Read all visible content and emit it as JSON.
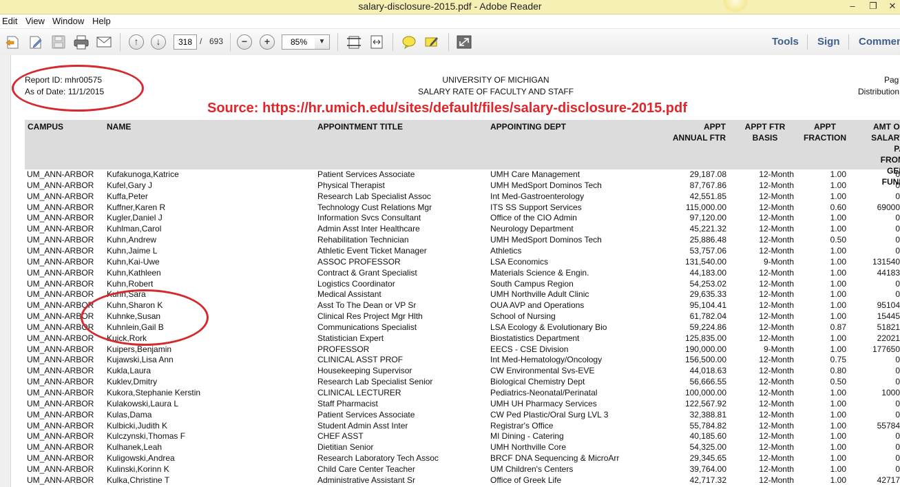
{
  "window": {
    "title": "salary-disclosure-2015.pdf - Adobe Reader",
    "minimize": "–",
    "restore": "❐",
    "close": "✕"
  },
  "menu": {
    "items": [
      "Edit",
      "View",
      "Window",
      "Help"
    ]
  },
  "toolbar": {
    "current_page": "318",
    "page_separator": "/",
    "total_pages": "693",
    "zoom": "85%",
    "zoom_out": "−",
    "zoom_in": "+",
    "prev_page": "↑",
    "next_page": "↓",
    "dropdown_arrow": "▼",
    "tools": "Tools",
    "sign": "Sign",
    "comment": "Commen"
  },
  "report": {
    "report_id": "Report ID: mhr00575",
    "as_of_date": "As of Date: 11/1/2015",
    "university": "UNIVERSITY OF MICHIGAN",
    "subtitle": "SALARY RATE OF FACULTY AND STAFF",
    "page_label": "Pag",
    "distribution_label": "Distribution",
    "source_note": "Source: https://hr.umich.edu/sites/default/files/salary-disclosure-2015.pdf"
  },
  "columns": {
    "campus": "CAMPUS",
    "name": "NAME",
    "title": "APPOINTMENT TITLE",
    "dept": "APPOINTING DEPT",
    "ftr": [
      "APPT",
      "ANNUAL FTR"
    ],
    "basis": [
      "APPT FTR",
      "BASIS"
    ],
    "fraction": [
      "APPT",
      "FRACTION"
    ],
    "gf": [
      "AMT OF",
      "SALARY PA",
      "FROM GEN",
      "FUND"
    ]
  },
  "rows": [
    [
      "UM_ANN-ARBOR",
      "Kufakunoga,Katrice",
      "Patient Services Associate",
      "UMH Care Management",
      "29,187.08",
      "12-Month",
      "1.00",
      "0"
    ],
    [
      "UM_ANN-ARBOR",
      "Kufel,Gary J",
      "Physical Therapist",
      "UMH MedSport Dominos Tech",
      "87,767.86",
      "12-Month",
      "1.00",
      "0"
    ],
    [
      "UM_ANN-ARBOR",
      "Kuffa,Peter",
      "Research Lab Specialist Assoc",
      "Int Med-Gastroenterology",
      "42,551.85",
      "12-Month",
      "1.00",
      "0"
    ],
    [
      "UM_ANN-ARBOR",
      "Kuffner,Karen R",
      "Technology Cust Relations Mgr",
      "ITS SS Support Services",
      "115,000.00",
      "12-Month",
      "0.60",
      "69000"
    ],
    [
      "UM_ANN-ARBOR",
      "Kugler,Daniel J",
      "Information Svcs Consultant",
      "Office of the CIO Admin",
      "97,120.00",
      "12-Month",
      "1.00",
      "0"
    ],
    [
      "UM_ANN-ARBOR",
      "Kuhlman,Carol",
      "Admin Asst Inter Healthcare",
      "Neurology Department",
      "45,221.32",
      "12-Month",
      "1.00",
      "0"
    ],
    [
      "UM_ANN-ARBOR",
      "Kuhn,Andrew",
      "Rehabilitation Technician",
      "UMH MedSport Dominos Tech",
      "25,886.48",
      "12-Month",
      "0.50",
      "0"
    ],
    [
      "UM_ANN-ARBOR",
      "Kuhn,Jaime L",
      "Athletic Event Ticket Manager",
      "Athletics",
      "53,757.06",
      "12-Month",
      "1.00",
      "0"
    ],
    [
      "UM_ANN-ARBOR",
      "Kuhn,Kai-Uwe",
      "ASSOC PROFESSOR",
      "LSA Economics",
      "131,540.00",
      "9-Month",
      "1.00",
      "131540"
    ],
    [
      "UM_ANN-ARBOR",
      "Kuhn,Kathleen",
      "Contract & Grant Specialist",
      "Materials Science & Engin.",
      "44,183.00",
      "12-Month",
      "1.00",
      "44183"
    ],
    [
      "UM_ANN-ARBOR",
      "Kuhn,Robert",
      "Logistics Coordinator",
      "South Campus Region",
      "54,253.02",
      "12-Month",
      "1.00",
      "0"
    ],
    [
      "UM_ANN-ARBOR",
      "Kuhn,Sara",
      "Medical Assistant",
      "UMH Northville Adult Clinic",
      "29,635.33",
      "12-Month",
      "1.00",
      "0"
    ],
    [
      "UM_ANN-ARBOR",
      "Kuhn,Sharon K",
      "Asst To The Dean or VP Sr",
      "OUA AVP and Operations",
      "95,104.41",
      "12-Month",
      "1.00",
      "95104"
    ],
    [
      "UM_ANN-ARBOR",
      "Kuhnke,Susan",
      "Clinical Res Project Mgr Hlth",
      "School of Nursing",
      "61,782.04",
      "12-Month",
      "1.00",
      "15445"
    ],
    [
      "UM_ANN-ARBOR",
      "Kuhnlein,Gail B",
      "Communications Specialist",
      "LSA Ecology & Evolutionary Bio",
      "59,224.86",
      "12-Month",
      "0.87",
      "51821"
    ],
    [
      "UM_ANN-ARBOR",
      "Kuick,Rork",
      "Statistician Expert",
      "Biostatistics Department",
      "125,835.00",
      "12-Month",
      "1.00",
      "22021"
    ],
    [
      "UM_ANN-ARBOR",
      "Kuipers,Benjamin",
      "PROFESSOR",
      "EECS - CSE Division",
      "190,000.00",
      "9-Month",
      "1.00",
      "177650"
    ],
    [
      "UM_ANN-ARBOR",
      "Kujawski,Lisa Ann",
      "CLINICAL ASST PROF",
      "Int Med-Hematology/Oncology",
      "156,500.00",
      "12-Month",
      "0.75",
      "0"
    ],
    [
      "UM_ANN-ARBOR",
      "Kukla,Laura",
      "Housekeeping Supervisor",
      "CW Environmental Svs-EVE",
      "44,018.63",
      "12-Month",
      "0.80",
      "0"
    ],
    [
      "UM_ANN-ARBOR",
      "Kuklev,Dmitry",
      "Research Lab Specialist Senior",
      "Biological Chemistry Dept",
      "56,666.55",
      "12-Month",
      "0.50",
      "0"
    ],
    [
      "UM_ANN-ARBOR",
      "Kukora,Stephanie Kerstin",
      "CLINICAL LECTURER",
      "Pediatrics-Neonatal/Perinatal",
      "100,000.00",
      "12-Month",
      "1.00",
      "1000"
    ],
    [
      "UM_ANN-ARBOR",
      "Kulakowski,Laura L",
      "Staff Pharmacist",
      "UMH UH Pharmacy Services",
      "122,567.92",
      "12-Month",
      "1.00",
      "0"
    ],
    [
      "UM_ANN-ARBOR",
      "Kulas,Dama",
      "Patient Services Associate",
      "CW Ped Plastic/Oral Surg LVL 3",
      "32,388.81",
      "12-Month",
      "1.00",
      "0"
    ],
    [
      "UM_ANN-ARBOR",
      "Kulbicki,Judith K",
      "Student Admin Asst Inter",
      "Registrar's Office",
      "55,784.82",
      "12-Month",
      "1.00",
      "55784"
    ],
    [
      "UM_ANN-ARBOR",
      "Kulczynski,Thomas F",
      "CHEF ASST",
      "MI Dining - Catering",
      "40,185.60",
      "12-Month",
      "1.00",
      "0"
    ],
    [
      "UM_ANN-ARBOR",
      "Kulhanek,Leah",
      "Dietitian Senior",
      "UMH Northville Core",
      "54,325.00",
      "12-Month",
      "1.00",
      "0"
    ],
    [
      "UM_ANN-ARBOR",
      "Kuligowski,Andrea",
      "Research Laboratory Tech Assoc",
      "BRCF DNA Sequencing & MicroArr",
      "29,345.65",
      "12-Month",
      "1.00",
      "0"
    ],
    [
      "UM_ANN-ARBOR",
      "Kulinski,Korinn K",
      "Child Care Center Teacher",
      "UM Children's Centers",
      "39,764.00",
      "12-Month",
      "1.00",
      "0"
    ],
    [
      "UM_ANN-ARBOR",
      "Kulka,Christine T",
      "Administrative Assistant Sr",
      "Office of Greek Life",
      "42,717.32",
      "12-Month",
      "1.00",
      "42717"
    ]
  ]
}
